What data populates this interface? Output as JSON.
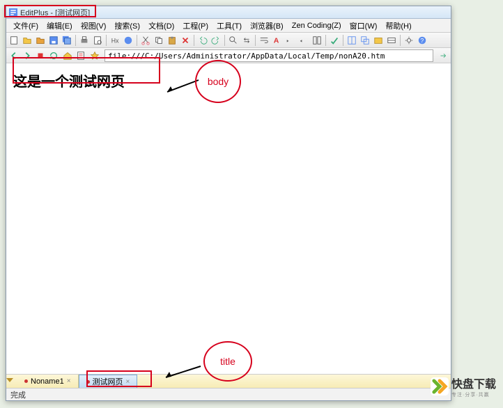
{
  "window": {
    "title": "EditPlus - [测试网页]"
  },
  "menu": {
    "items": [
      "文件(F)",
      "编辑(E)",
      "视图(V)",
      "搜索(S)",
      "文档(D)",
      "工程(P)",
      "工具(T)",
      "浏览器(B)",
      "Zen Coding(Z)",
      "窗口(W)",
      "帮助(H)"
    ]
  },
  "address": {
    "url": "file:///C:/Users/Administrator/AppData/Local/Temp/nonA20.htm"
  },
  "page": {
    "heading": "这是一个测试网页"
  },
  "tabs": {
    "items": [
      {
        "label": "Noname1",
        "active": false
      },
      {
        "label": "测试网页",
        "active": true
      }
    ]
  },
  "status": {
    "text": "完成"
  },
  "annotations": {
    "body_label": "body",
    "title_label": "title"
  },
  "watermark": {
    "text": "快盘下载",
    "sub": "专注·分享·共赢"
  }
}
